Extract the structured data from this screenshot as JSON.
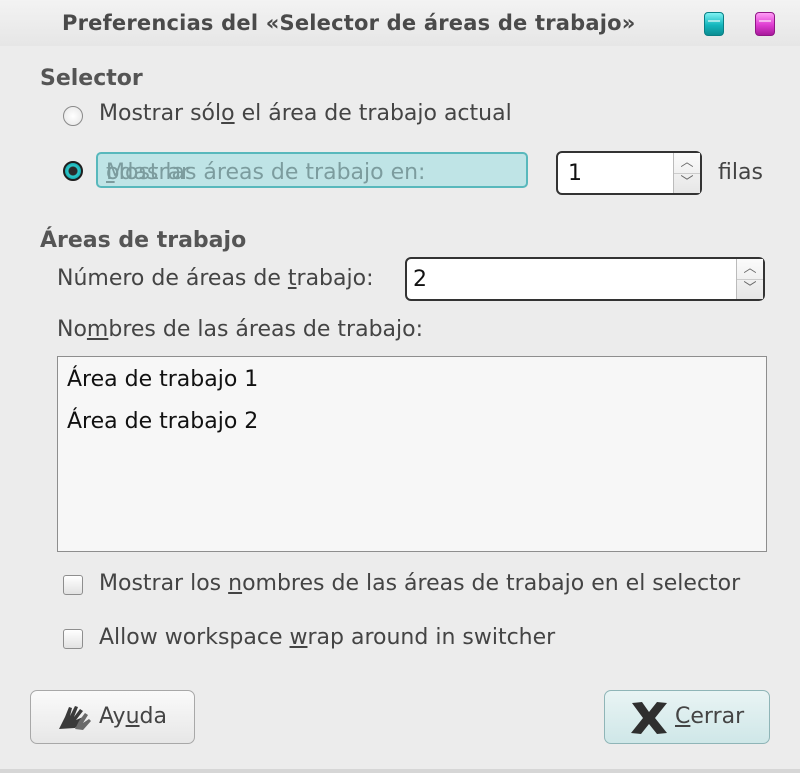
{
  "window": {
    "title": "Preferencias del «Selector de áreas de trabajo»"
  },
  "selector": {
    "heading": "Selector",
    "radio_current": {
      "pre": "Mostrar sól",
      "mnemonic": "o",
      "post": " el área de trabajo actual",
      "checked": false
    },
    "radio_all": {
      "pre": "Mostrar ",
      "mnemonic": "t",
      "post": "odas las áreas de trabajo en:",
      "checked": true
    },
    "rows_value": "1",
    "rows_unit": "filas"
  },
  "workspaces": {
    "heading": "Áreas de trabajo",
    "count_label_pre": "Número de áreas de ",
    "count_label_mnemonic": "t",
    "count_label_post": "rabajo:",
    "count_value": "2",
    "names_label_pre": "No",
    "names_label_mnemonic": "m",
    "names_label_post": "bres de las áreas de trabajo:",
    "names": [
      "Área de trabajo 1",
      "Área de trabajo 2"
    ]
  },
  "options": {
    "show_names": {
      "pre": "Mostrar los ",
      "mnemonic": "n",
      "post": "ombres de las áreas de trabajo en el selector",
      "checked": false
    },
    "wrap": {
      "pre": "Allow workspace ",
      "mnemonic": "w",
      "post": "rap around in switcher",
      "checked": false
    }
  },
  "buttons": {
    "help": {
      "pre": "Ay",
      "mnemonic": "u",
      "post": "da",
      "icon": "help-hands-icon"
    },
    "close": {
      "pre": "",
      "mnemonic": "C",
      "post": "errar",
      "icon": "close-x-icon"
    }
  },
  "colors": {
    "accent": "#2ec9cc",
    "selection_bg": "#bfe4e6",
    "window_btn_1": "#14b6bd",
    "window_btn_2": "#de3cd1"
  }
}
